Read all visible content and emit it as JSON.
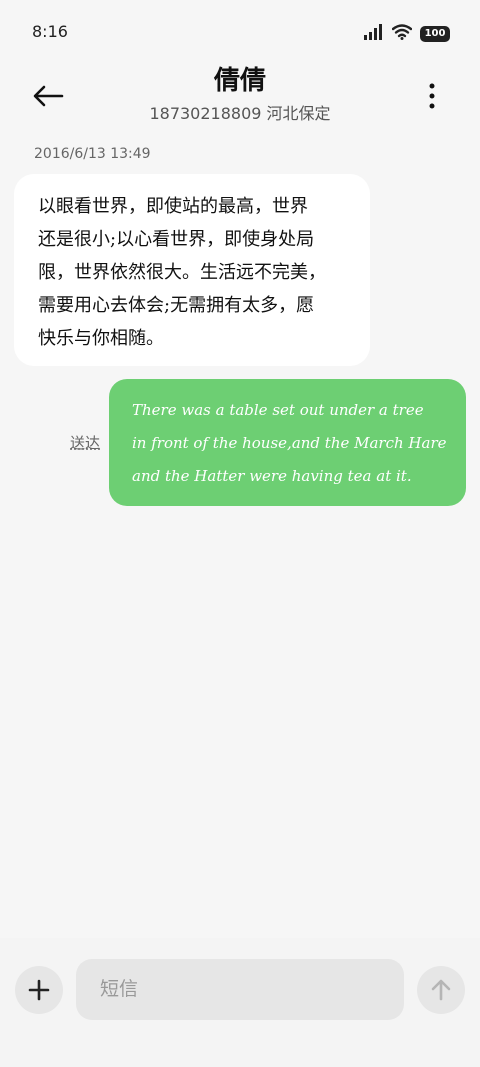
{
  "status_bar": {
    "time": "8:16",
    "battery": "100",
    "icons": [
      "signal-icon",
      "wifi-icon",
      "battery-icon"
    ]
  },
  "header": {
    "contact_name": "倩倩",
    "contact_sub": "18730218809 河北保定",
    "icons": [
      "back-arrow-icon",
      "more-vertical-icon"
    ]
  },
  "conversation": {
    "timestamp": "2016/6/13 13:49",
    "incoming_lines": [
      "以眼看世界，即使站的最高，世界",
      "还是很小;以心看世界，即使身处局",
      "限，世界依然很大。生活远不完美，",
      "需要用心去体会;无需拥有太多，愿",
      "快乐与你相随。"
    ],
    "outgoing_lines": [
      "There was a table set out under a tree",
      "in front of the house,and the March Hare",
      "and the Hatter were having tea at it."
    ],
    "delivery_status": "送达",
    "outgoing_color": "#6dcf73"
  },
  "composer": {
    "placeholder": "短信",
    "icons": [
      "plus-icon",
      "send-arrow-up-icon"
    ]
  }
}
